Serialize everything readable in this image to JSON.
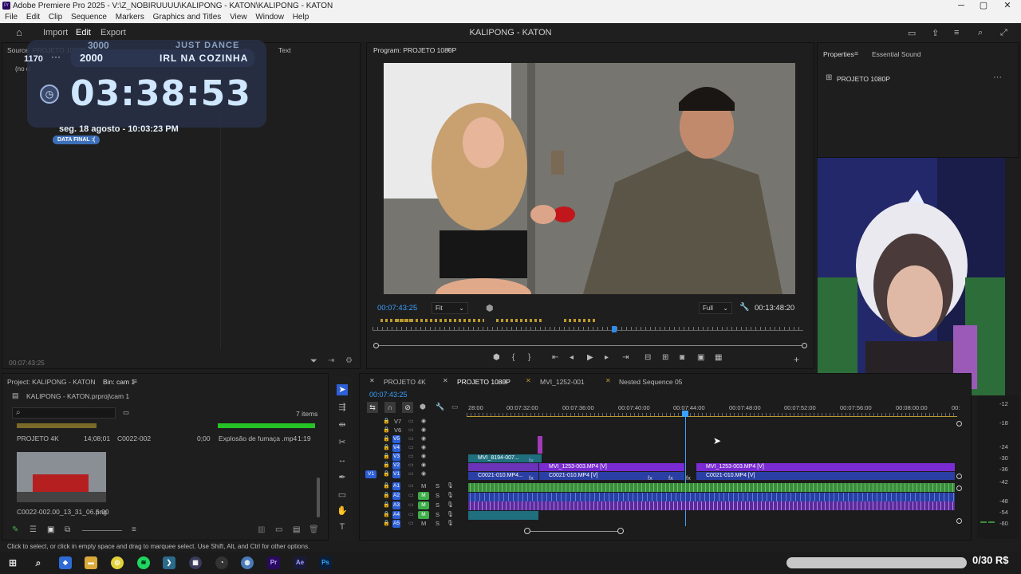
{
  "window": {
    "title": "Adobe Premiere Pro 2025 - V:\\Z_NOBIRUUUU\\KALIPONG - KATON\\KALIPONG - KATON",
    "icon": "Pr"
  },
  "menu": [
    "File",
    "Edit",
    "Clip",
    "Sequence",
    "Markers",
    "Graphics and Titles",
    "View",
    "Window",
    "Help"
  ],
  "header": {
    "tabs": [
      "Import",
      "Edit",
      "Export"
    ],
    "project_title": "KALIPONG - KATON"
  },
  "overlay": {
    "goal_top": "3000",
    "goal_top_label": "JUST DANCE",
    "goal_mid": "2000",
    "goal_mid_label": "IRL NA COZINHA",
    "count": "1170",
    "timer": "03:38:53",
    "date": "seg. 18 agosto - 10:03:23 PM",
    "badge": "DATA FINAL :("
  },
  "source_panel": {
    "tab": "Source: PROJETO 1080P: M",
    "tab_effects": "ffects",
    "tab_text": "Text",
    "no_clip": "(no cl",
    "timecode": "00:07:43:25"
  },
  "program": {
    "tab": "Program: PROJETO 1080P",
    "timecode": "00:07:43:25",
    "fit": "Fit",
    "quality": "Full",
    "duration": "00:13:48:20"
  },
  "properties": {
    "tab": "Properties",
    "tab2": "Essential Sound",
    "item": "PROJETO 1080P"
  },
  "project_panel": {
    "tab": "Project: KALIPONG - KATON",
    "bin": "Bin: cam 1",
    "file": "KALIPONG - KATON.prproj\\cam 1",
    "items_count": "7 items",
    "items": [
      {
        "name": "PROJETO 4K",
        "dur": "14;08;01"
      },
      {
        "name": "C0022-002",
        "dur": "0;00"
      },
      {
        "name": "Explosão de fumaça .mp4",
        "dur": "1:19"
      },
      {
        "name": "C0022-002.00_13_31_06.png",
        "dur": "5:00"
      }
    ]
  },
  "timeline": {
    "tabs": [
      "PROJETO 4K",
      "PROJETO 1080P",
      "MVI_1252-001",
      "Nested Sequence 05"
    ],
    "timecode": "00:07:43:25",
    "ruler": [
      "28:00",
      "00:07:32:00",
      "00:07:36:00",
      "00:07:40:00",
      "00:07:44:00",
      "00:07:48:00",
      "00:07:52:00",
      "00:07:56:00",
      "00:08:00:00",
      "00:"
    ],
    "video_tracks": [
      "V7",
      "V6",
      "V5",
      "V4",
      "V3",
      "V2",
      "V1"
    ],
    "audio_tracks": [
      "A1",
      "A2",
      "A3",
      "A4",
      "A5"
    ],
    "source_v": "V1",
    "mute_label": "M",
    "solo_label": "S",
    "fx_label": "fx",
    "clips": {
      "v3": "MVI_8194-007...",
      "v2a": "MVI_1253-003.MP4 [V]",
      "v2b": "MVI_1253-003.MP4 [V]",
      "v1a": "C0021-010.MP4...",
      "v1b": "C0021-010.MP4 [V]",
      "v1c": "C0021-010.MP4 [V]"
    },
    "meter_ticks": [
      "-12",
      "-18",
      "-24",
      "-30",
      "-36",
      "-42",
      "-48",
      "-54",
      "-60"
    ]
  },
  "status": {
    "text": "Click to select, or click in empty space and drag to marquee select. Use Shift, Alt, and Ctrl for other options.",
    "donation": "0/30 R$"
  },
  "taskbar": [
    "Pr",
    "Ae",
    "Ps"
  ],
  "colors": {
    "accent": "#2d8ceb",
    "clip_purple": "#7a2bd1",
    "clip_blue": "#2a3fa3",
    "clip_teal": "#1f6f7f",
    "audio_green": "#3a8d3a",
    "overlay_text": "#cfe7ff"
  }
}
